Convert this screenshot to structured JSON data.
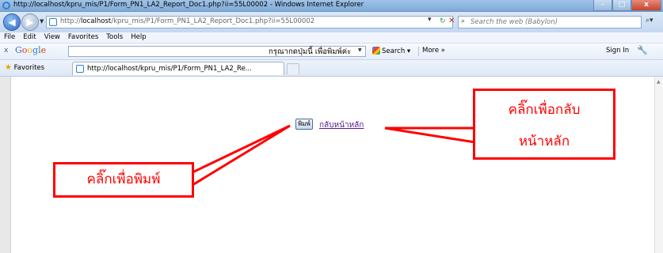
{
  "window": {
    "title": "http://localhost/kpru_mis/P1/Form_PN1_LA2_Report_Doc1.php?ii=55L00002 - Windows Internet Explorer",
    "minimize": "–",
    "maximize": "□",
    "close": "x"
  },
  "address": {
    "url_prefix": "http://",
    "url_host": "localhost",
    "url_path": "/kpru_mis/P1/Form_PN1_LA2_Report_Doc1.php?ii=55L00002",
    "search_placeholder": "Search the web (Babylon)"
  },
  "menu": [
    "File",
    "Edit",
    "View",
    "Favorites",
    "Tools",
    "Help"
  ],
  "google_toolbar": {
    "close": "x",
    "logo": "Google",
    "search_label": "Search",
    "more_label": "More",
    "sign_in": "Sign In"
  },
  "favorites_bar": {
    "favorites_label": "Favorites",
    "tab_title": "http://localhost/kpru_mis/P1/Form_PN1_LA2_Re..."
  },
  "page": {
    "prompt": "กรุณากดปุ่มนี้ เพื่อพิมพ์ค่ะ",
    "print_button": "พิมพ์",
    "home_link": "กลับหน้าหลัก"
  },
  "annotations": {
    "print_callout": "คลิ๊กเพื่อพิมพ์",
    "home_callout_line1": "คลิ๊กเพื่อกลับ",
    "home_callout_line2": "หน้าหลัก"
  },
  "colors": {
    "callout": "#ff0000",
    "visited_link": "#551a8b"
  }
}
